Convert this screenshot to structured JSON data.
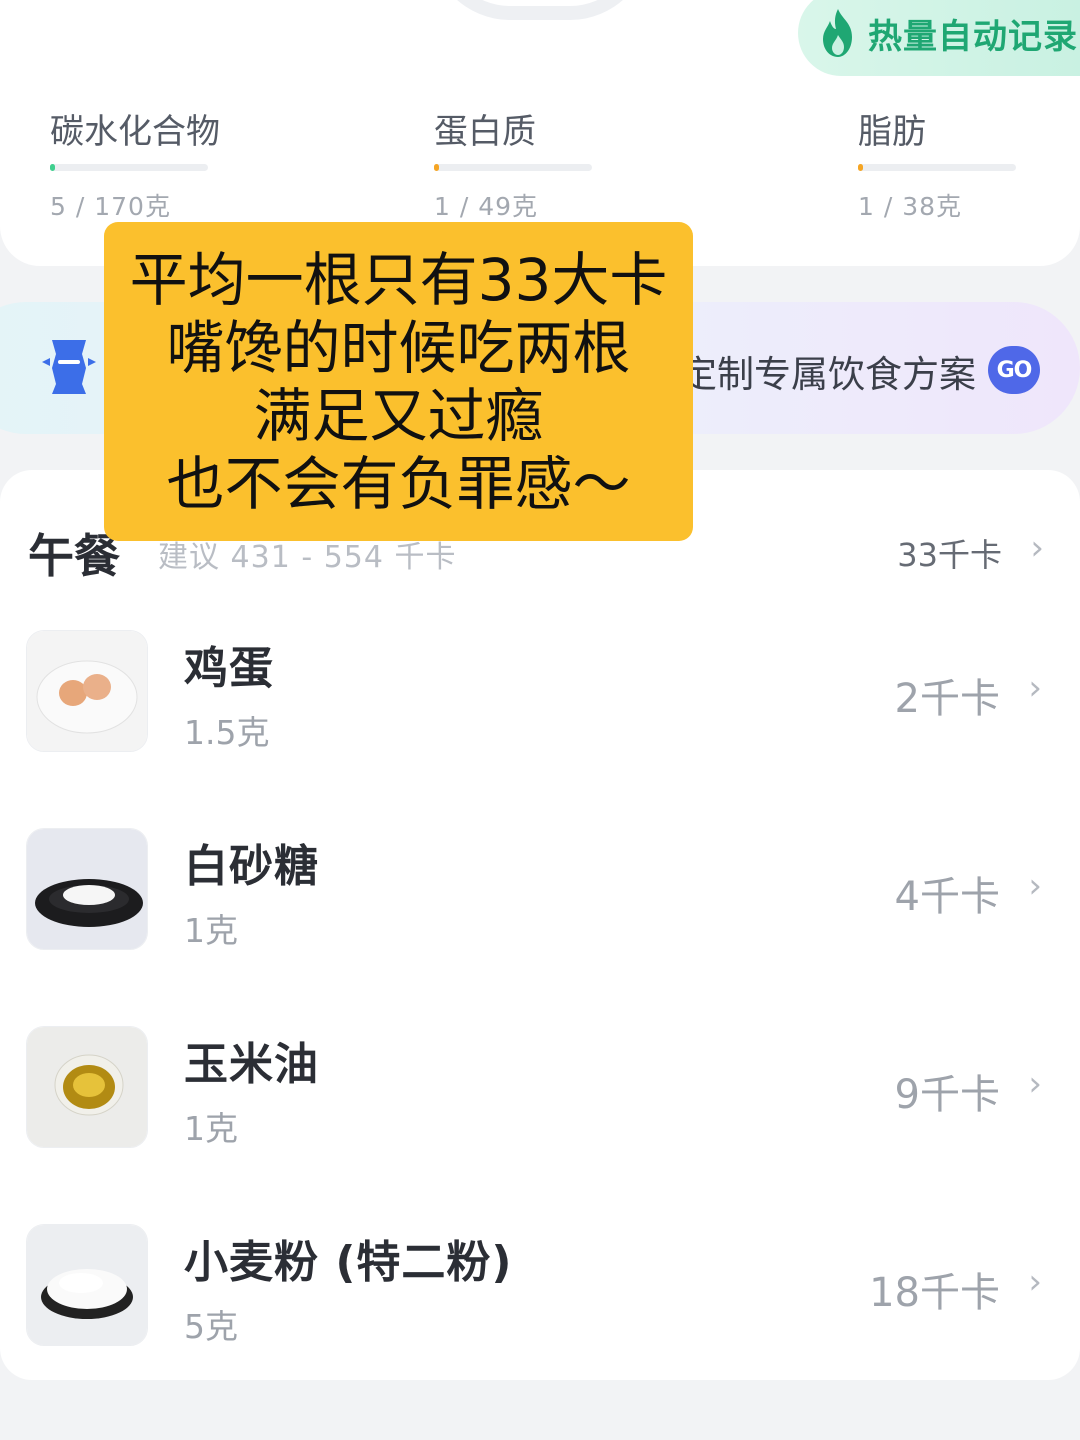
{
  "header": {
    "auto_record_label": "热量自动记录"
  },
  "macros": [
    {
      "name": "碳水化合物",
      "amount": "5 / 170克",
      "progress": 0.03,
      "color": "#3fcf8e"
    },
    {
      "name": "蛋白质",
      "amount": "1 / 49克",
      "progress": 0.02,
      "color": "#f5a524"
    },
    {
      "name": "脂肪",
      "amount": "1 / 38克",
      "progress": 0.03,
      "color": "#f5a524"
    }
  ],
  "banner": {
    "text": "定制专属饮食方案",
    "badge": "GO"
  },
  "meal": {
    "title": "午餐",
    "suggestion": "建议 431 - 554 千卡",
    "total": "33千卡",
    "items": [
      {
        "name": "鸡蛋",
        "amount": "1.5克",
        "calories": "2千卡",
        "image": "eggs-on-plate"
      },
      {
        "name": "白砂糖",
        "amount": "1克",
        "calories": "4千卡",
        "image": "sugar-in-bowl"
      },
      {
        "name": "玉米油",
        "amount": "1克",
        "calories": "9千卡",
        "image": "oil-in-dish"
      },
      {
        "name": "小麦粉 (特二粉)",
        "amount": "5克",
        "calories": "18千卡",
        "image": "flour-in-bowl"
      }
    ]
  },
  "caption": {
    "lines": [
      "平均一根只有33大卡",
      "嘴馋的时候吃两根",
      "满足又过瘾",
      "也不会有负罪感～"
    ]
  },
  "colors": {
    "accent_green": "#1fa773",
    "caption_bg": "#fbc02d",
    "badge_blue": "#4f68e8"
  }
}
